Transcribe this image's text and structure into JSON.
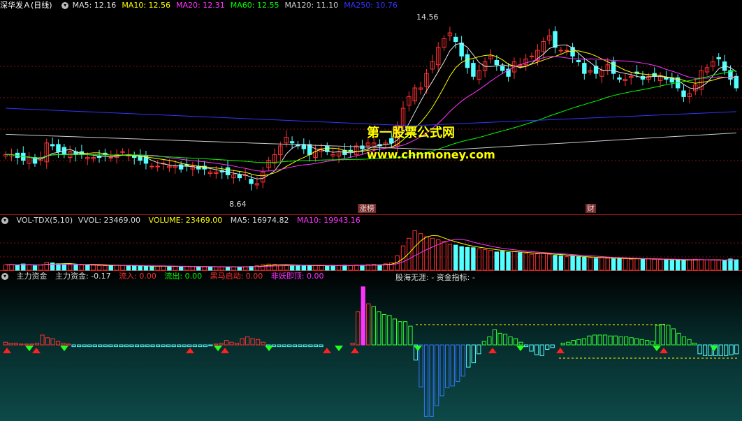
{
  "price_panel": {
    "stock_name": "深华发Ａ",
    "period": "(日线)",
    "ctl_glyph": "▾",
    "ma": [
      {
        "label": "MA5: ",
        "value": "12.16",
        "color": "#e0e0e0"
      },
      {
        "label": "MA10: ",
        "value": "12.56",
        "color": "#ffff00"
      },
      {
        "label": "MA20: ",
        "value": "12.31",
        "color": "#ff33ff"
      },
      {
        "label": "MA60: ",
        "value": "12.55",
        "color": "#00ff00"
      },
      {
        "label": "MA120: ",
        "value": "11.10",
        "color": "#cccccc"
      },
      {
        "label": "MA250: ",
        "value": "10.76",
        "color": "#3333ff"
      }
    ],
    "high_label": "14.56",
    "low_label": "8.64",
    "tag_left": "涨榜",
    "tag_right": "财",
    "watermark_cn": "第一股票公式网",
    "watermark_url": "www.chnmoney.com"
  },
  "volume_panel": {
    "name": "VOL-TDX(5,10)",
    "vvol": "VVOL: 23469.00",
    "volume": "VOLUME: 23469.00",
    "ma5": "MA5: 16974.82",
    "ma10": "MA10: 19943.16"
  },
  "fund_panel": {
    "name": "主力资金",
    "main_fund": "主力资金: -0.17",
    "inflow": "流入: 0.00",
    "outflow": "流出: 0.00",
    "darkhorse": "黑马启动: 0.00",
    "monster": "非妖即顶: 0.00",
    "middle_text": "股海无涯: -  资金指标: -"
  },
  "colors": {
    "up": "#ff3232",
    "down": "#54ffff",
    "grid": "#7a1515",
    "divider": "#b01818"
  },
  "chart_data": {
    "type": "candlestick",
    "title": "深华发Ａ (日线)",
    "price_range": [
      8.64,
      14.56
    ],
    "annotated_high": 14.56,
    "annotated_low": 8.64,
    "close_approx": [
      10.0,
      10.0,
      9.9,
      9.8,
      9.9,
      9.7,
      9.9,
      10.4,
      10.3,
      10.1,
      10.0,
      10.1,
      10.0,
      10.0,
      9.9,
      9.9,
      9.9,
      10.0,
      9.9,
      10.0,
      10.1,
      10.0,
      9.9,
      9.8,
      9.7,
      9.6,
      9.6,
      9.7,
      9.6,
      9.6,
      9.5,
      9.6,
      9.6,
      9.5,
      9.5,
      9.4,
      9.4,
      9.4,
      9.3,
      9.3,
      9.2,
      9.3,
      9.0,
      9.0,
      9.4,
      9.8,
      10.0,
      10.3,
      10.6,
      10.4,
      10.3,
      10.2,
      10.0,
      10.1,
      10.2,
      10.1,
      10.0,
      10.1,
      10.0,
      10.1,
      10.3,
      10.2,
      10.4,
      10.4,
      10.3,
      10.4,
      10.4,
      11.0,
      11.6,
      12.0,
      12.3,
      12.3,
      12.8,
      13.2,
      13.7,
      14.0,
      14.2,
      13.9,
      13.4,
      13.0,
      12.7,
      12.9,
      13.2,
      13.4,
      13.1,
      12.9,
      12.7,
      13.2,
      13.1,
      13.3,
      13.4,
      13.6,
      13.9,
      14.1,
      13.7,
      13.6,
      13.6,
      13.4,
      13.2,
      12.8,
      12.9,
      12.8,
      12.9,
      13.1,
      12.8,
      12.6,
      12.6,
      12.7,
      12.8,
      12.6,
      12.7,
      12.7,
      12.7,
      12.6,
      12.5,
      12.3,
      12.0,
      12.1,
      12.4,
      12.9,
      13.0,
      13.2,
      13.3,
      12.9,
      12.6,
      12.3
    ],
    "volume_approx": [
      3500,
      3800,
      3200,
      4100,
      3600,
      2900,
      3300,
      5200,
      4800,
      4200,
      3900,
      3700,
      3500,
      3400,
      3200,
      3300,
      3100,
      3000,
      3200,
      3400,
      3100,
      2900,
      2800,
      2700,
      2600,
      2500,
      2600,
      2700,
      2500,
      2400,
      2300,
      2500,
      2400,
      2300,
      2200,
      2300,
      2200,
      2100,
      2000,
      2200,
      2100,
      2300,
      2500,
      3000,
      3600,
      4000,
      3800,
      3400,
      3200,
      3100,
      3300,
      3000,
      2900,
      3100,
      3000,
      2900,
      3200,
      3100,
      3300,
      3000,
      3400,
      3300,
      3600,
      3800,
      3500,
      4200,
      4800,
      9500,
      16000,
      21000,
      26000,
      24000,
      22000,
      21000,
      20000,
      19000,
      17000,
      16500,
      15500,
      15000,
      14800,
      14000,
      13500,
      13000,
      12000,
      12500,
      11800,
      12200,
      11500,
      11000,
      10500,
      10800,
      11000,
      10500,
      9800,
      9500,
      8900,
      9200,
      8800,
      8500,
      8200,
      7800,
      8200,
      7900,
      7500,
      7800,
      7600,
      7200,
      7500,
      7400,
      7600,
      7200,
      7000,
      6800,
      6500,
      6800,
      6500,
      6900,
      7200,
      7000,
      6800,
      6600,
      6500,
      6300,
      7400,
      6900,
      6700
    ],
    "fund_bars_approx": [
      0.03,
      0.02,
      0.02,
      0.01,
      0.01,
      0.01,
      0.02,
      0.11,
      0.08,
      0.07,
      0.04,
      0.02,
      0.01,
      -0.02,
      -0.02,
      -0.02,
      -0.02,
      -0.02,
      -0.02,
      -0.02,
      -0.02,
      -0.02,
      -0.02,
      -0.02,
      -0.02,
      -0.02,
      -0.02,
      -0.02,
      -0.02,
      -0.02,
      -0.02,
      -0.02,
      -0.02,
      -0.02,
      -0.02,
      -0.02,
      -0.02,
      -0.02,
      -0.02,
      -0.01,
      0.01,
      0.02,
      0.05,
      0.03,
      0.02,
      0.07,
      0.09,
      0.07,
      0.06,
      0.03,
      -0.02,
      -0.02,
      -0.02,
      -0.02,
      -0.02,
      -0.02,
      -0.02,
      -0.02,
      -0.02,
      -0.02,
      -0.02,
      0.0,
      0.0,
      0.0,
      0.0,
      0.0,
      0.02,
      0.37,
      0.65,
      0.46,
      0.43,
      0.37,
      0.34,
      0.33,
      0.29,
      0.26,
      0.26,
      0.21,
      -0.17,
      -0.47,
      -0.8,
      -0.8,
      -0.68,
      -0.57,
      -0.48,
      -0.46,
      -0.41,
      -0.35,
      -0.25,
      -0.2,
      -0.1,
      0.04,
      0.09,
      0.17,
      0.13,
      0.12,
      0.09,
      0.07,
      0.03,
      -0.02,
      -0.07,
      -0.11,
      -0.12,
      -0.05,
      -0.03,
      0.0,
      0.02,
      0.03,
      0.05,
      0.06,
      0.07,
      0.1,
      0.11,
      0.11,
      0.11,
      0.1,
      0.1,
      0.09,
      0.09,
      0.08,
      0.07,
      0.06,
      0.05,
      0.04,
      0.22,
      0.23,
      0.22,
      0.18,
      0.13,
      0.09,
      0.06,
      0.02,
      -0.1,
      -0.12,
      -0.12,
      -0.12,
      -0.12,
      -0.12,
      -0.11,
      -0.1
    ]
  }
}
